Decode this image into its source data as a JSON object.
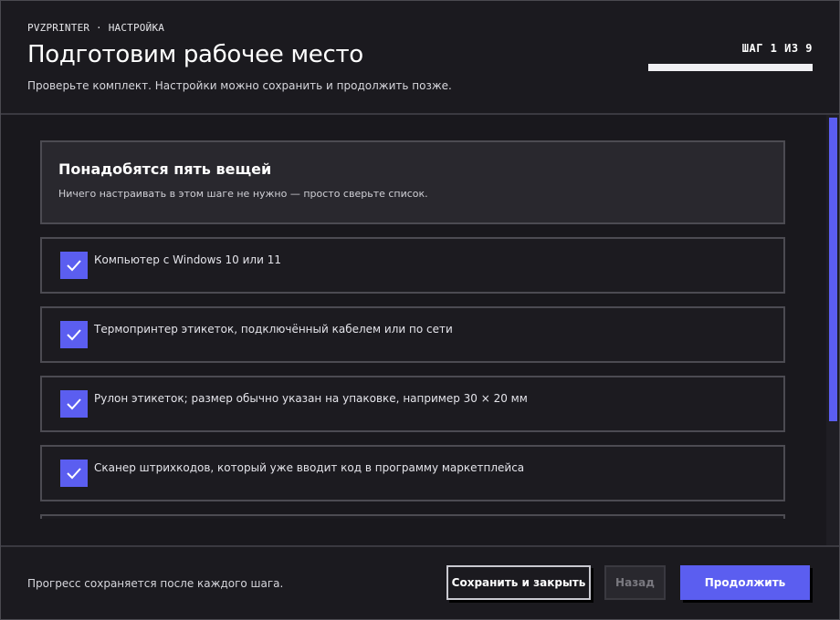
{
  "header": {
    "breadcrumb": "PVZPRINTER · НАСТРОЙКА",
    "title": "Подготовим рабочее место",
    "subtitle": "Проверьте комплект. Настройки можно сохранить и продолжить позже.",
    "step_label": "ШАГ 1 ИЗ 9",
    "step_current": 1,
    "step_total": 9
  },
  "intro": {
    "title": "Понадобятся пять вещей",
    "text": "Ничего настраивать в этом шаге не нужно — просто сверьте список."
  },
  "checklist": [
    {
      "label": "Компьютер с Windows 10 или 11",
      "checked": true
    },
    {
      "label": "Термопринтер этикеток, подключённый кабелем или по сети",
      "checked": true
    },
    {
      "label": "Рулон этикеток; размер обычно указан на упаковке, например 30 × 20 мм",
      "checked": true
    },
    {
      "label": "Сканер штрихкодов, который уже вводит код в программу маркетплейса",
      "checked": true
    }
  ],
  "footer": {
    "note": "Прогресс сохраняется после каждого шага.",
    "save_label": "Сохранить и закрыть",
    "back_label": "Назад",
    "next_label": "Продолжить"
  },
  "colors": {
    "accent": "#5b5ef0",
    "background": "#19181d",
    "card": "#29282e",
    "border": "#4c4b52"
  }
}
